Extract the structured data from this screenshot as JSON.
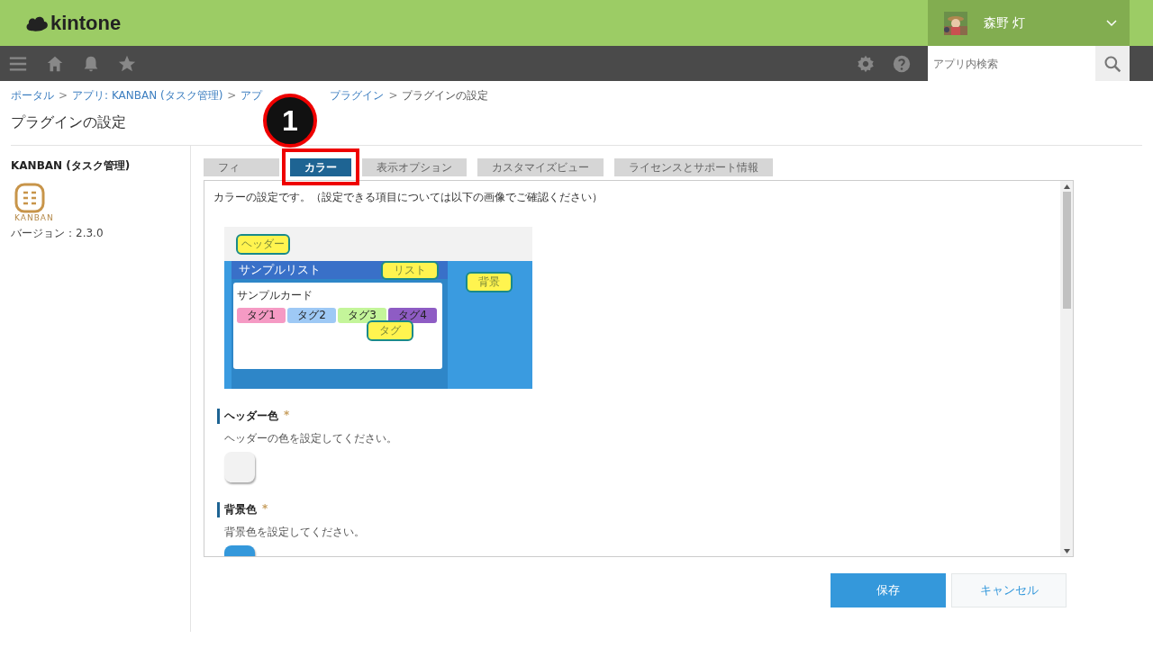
{
  "header": {
    "logo": "kintone",
    "user": {
      "name": "森野 灯"
    }
  },
  "toolbar": {
    "search": {
      "placeholder": "アプリ内検索"
    }
  },
  "breadcrumb_separator": ">",
  "breadcrumb": [
    {
      "label": "ポータル",
      "link": true
    },
    {
      "label": "アプリ: KANBAN (タスク管理)",
      "link": true
    },
    {
      "label": "アプ",
      "link": true
    },
    {
      "label": "プラグイン",
      "link": true
    },
    {
      "label": "プラグインの設定",
      "link": false
    }
  ],
  "page_title": "プラグインの設定",
  "plugin": {
    "name": "KANBAN (タスク管理)",
    "icon_caption": "KANBAN",
    "version": "バージョン：2.3.0"
  },
  "tabs": [
    {
      "label": "フィ",
      "selected": false
    },
    {
      "label": "カラー",
      "selected": true
    },
    {
      "label": "表示オプション",
      "selected": false
    },
    {
      "label": "カスタマイズビュー",
      "selected": false
    },
    {
      "label": "ライセンスとサポート情報",
      "selected": false
    }
  ],
  "annotation": {
    "number": "1"
  },
  "panel": {
    "intro": "カラーの設定です。（設定できる項目については以下の画像でご確認ください）",
    "preview": {
      "header_label": "ヘッダー",
      "list_title": "サンプルリスト",
      "list_label": "リスト",
      "background_label": "背景",
      "card_title": "サンプルカード",
      "tag_label": "タグ",
      "tags": [
        {
          "label": "タグ1",
          "color": "#f59ac4"
        },
        {
          "label": "タグ2",
          "color": "#9ec9f5"
        },
        {
          "label": "タグ3",
          "color": "#c4f59a"
        },
        {
          "label": "タグ4",
          "color": "#8e5cc4"
        }
      ]
    },
    "settings": [
      {
        "label": "ヘッダー色",
        "required": true,
        "required_mark": "*",
        "description": "ヘッダーの色を設定してください。",
        "color": "#f2f2f2"
      },
      {
        "label": "背景色",
        "required": true,
        "required_mark": "*",
        "description": "背景色を設定してください。",
        "color": "#3498db"
      }
    ]
  },
  "buttons": [
    {
      "label": "保存",
      "kind": "primary"
    },
    {
      "label": "キャンセル",
      "kind": "secondary"
    }
  ]
}
